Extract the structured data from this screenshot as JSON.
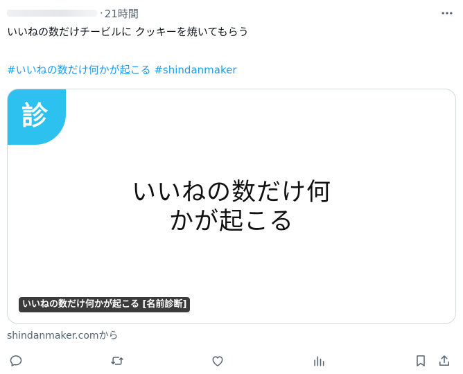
{
  "header": {
    "separator": "·",
    "time_ago": "21時間"
  },
  "tweet": {
    "text": "いいねの数だけチービルに クッキーを焼いてもらう",
    "hashtags": [
      "#いいねの数だけ何かが起こる",
      "#shindanmaker"
    ]
  },
  "card": {
    "logo_text": "診",
    "headline_line1": "いいねの数だけ何",
    "headline_line2": "かが起こる",
    "caption": "いいねの数だけ何かが起こる [名前診断]",
    "source": "shindanmaker.comから"
  },
  "icons": {
    "more": "more-icon",
    "reply": "reply-icon",
    "retweet": "retweet-icon",
    "like": "like-icon",
    "views": "views-icon",
    "bookmark": "bookmark-icon",
    "share": "share-icon"
  },
  "colors": {
    "link": "#1d9bf0",
    "muted": "#536471",
    "logo_bg": "#2cc1ef",
    "border": "#cfd9de"
  }
}
